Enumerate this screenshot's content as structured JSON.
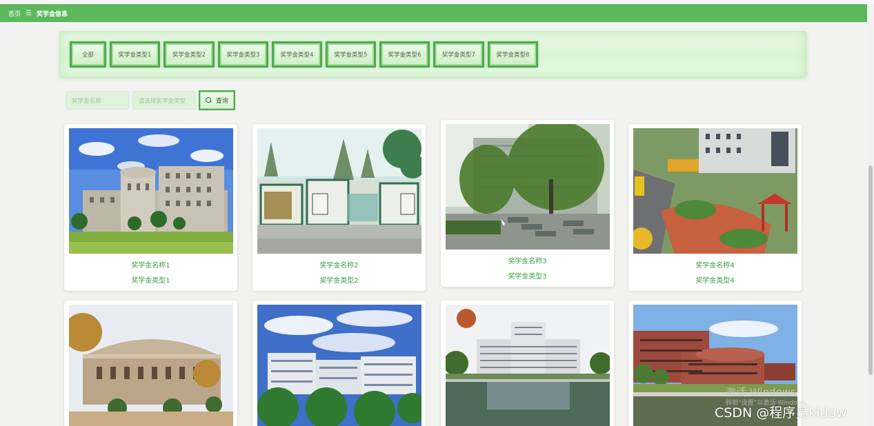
{
  "breadcrumb": {
    "home": "首页",
    "separator": "☰",
    "current": "奖学金信息"
  },
  "categories": [
    "全部",
    "奖学金类型1",
    "奖学金类型2",
    "奖学金类型3",
    "奖学金类型4",
    "奖学金类型5",
    "奖学金类型6",
    "奖学金类型7",
    "奖学金类型8"
  ],
  "search": {
    "name_placeholder": "奖学金名称",
    "type_placeholder": "请选择奖学金类型",
    "query_label": "查询"
  },
  "cards": [
    {
      "name": "奖学金名称1",
      "type": "奖学金类型1",
      "photo": "campus-building-blue-sky"
    },
    {
      "name": "奖学金名称2",
      "type": "奖学金类型2",
      "photo": "campus-gate-plaza"
    },
    {
      "name": "奖学金名称3",
      "type": "奖学金类型3",
      "photo": "willow-trees-courtyard"
    },
    {
      "name": "奖学金名称4",
      "type": "奖学金类型4",
      "photo": "campus-aerial-pavilion"
    },
    {
      "name": "",
      "type": "",
      "photo": "domed-building-autumn"
    },
    {
      "name": "",
      "type": "",
      "photo": "white-buildings-trees"
    },
    {
      "name": "",
      "type": "",
      "photo": "main-building-reflecting-pool"
    },
    {
      "name": "",
      "type": "",
      "photo": "red-brick-building-lake"
    }
  ],
  "watermark": {
    "os_line1": "激活 Windows",
    "os_line2": "转到“设置”以激活 Windows。",
    "csdn": "CSDN @程序员kidow"
  },
  "colors": {
    "header_green": "#5cb85c",
    "accent_green": "#43a047",
    "button_border": "#4fa94f",
    "page_bg": "#f2f3f1"
  }
}
